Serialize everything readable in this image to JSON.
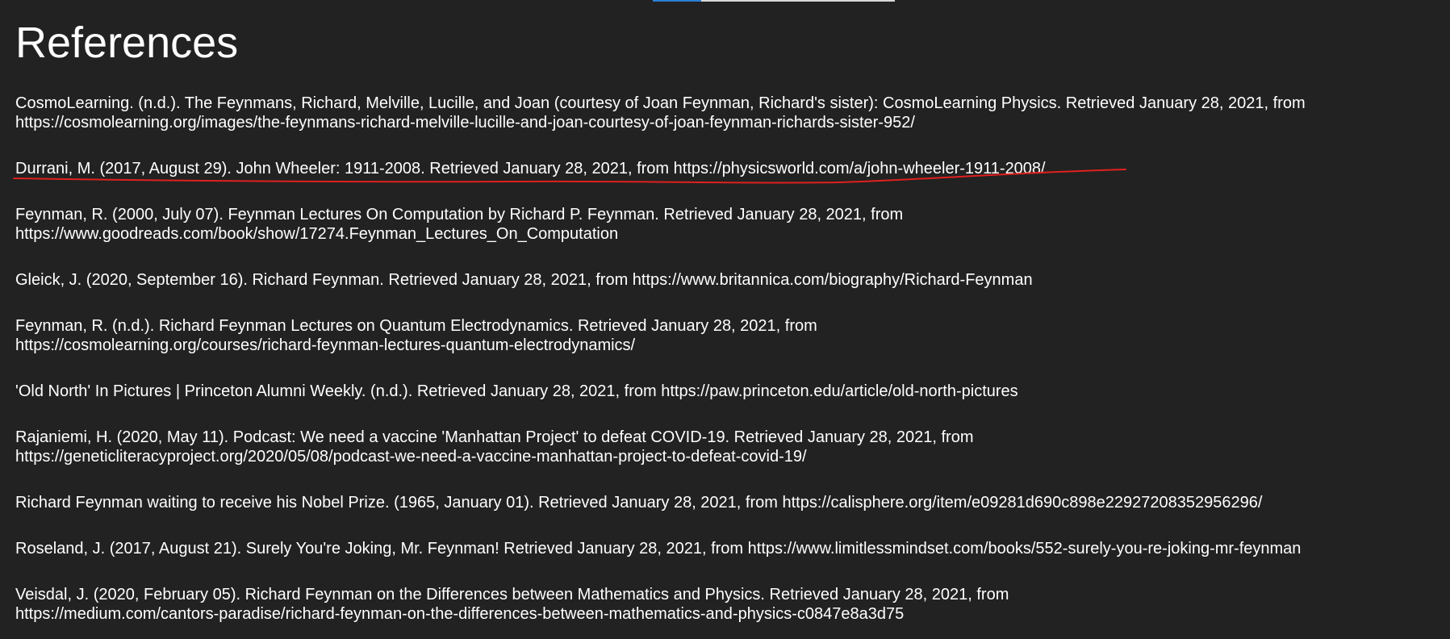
{
  "page": {
    "title": "References"
  },
  "references": [
    {
      "line1": "CosmoLearning. (n.d.). The Feynmans, Richard, Melville, Lucille, and Joan (courtesy of Joan Feynman, Richard's sister): CosmoLearning Physics. Retrieved January 28, 2021, from",
      "line2": "https://cosmolearning.org/images/the-feynmans-richard-melville-lucille-and-joan-courtesy-of-joan-feynman-richards-sister-952/"
    },
    {
      "line1": "Durrani, M. (2017, August 29). John Wheeler: 1911-2008. Retrieved January 28, 2021, from https://physicsworld.com/a/john-wheeler-1911-2008/",
      "line2": ""
    },
    {
      "line1": "Feynman, R. (2000, July 07). Feynman Lectures On Computation by Richard P. Feynman. Retrieved January 28, 2021, from",
      "line2": "https://www.goodreads.com/book/show/17274.Feynman_Lectures_On_Computation"
    },
    {
      "line1": "Gleick, J. (2020, September 16). Richard Feynman. Retrieved January 28, 2021, from https://www.britannica.com/biography/Richard-Feynman",
      "line2": ""
    },
    {
      "line1": "Feynman, R. (n.d.). Richard Feynman Lectures on Quantum Electrodynamics. Retrieved January 28, 2021, from",
      "line2": "https://cosmolearning.org/courses/richard-feynman-lectures-quantum-electrodynamics/"
    },
    {
      "line1": "'Old North' In Pictures | Princeton Alumni Weekly. (n.d.). Retrieved January 28, 2021, from https://paw.princeton.edu/article/old-north-pictures",
      "line2": ""
    },
    {
      "line1": "Rajaniemi, H. (2020, May 11). Podcast: We need a vaccine 'Manhattan Project' to defeat COVID-19. Retrieved January 28, 2021, from",
      "line2": "https://geneticliteracyproject.org/2020/05/08/podcast-we-need-a-vaccine-manhattan-project-to-defeat-covid-19/"
    },
    {
      "line1": "Richard Feynman waiting to receive his Nobel Prize. (1965, January 01). Retrieved January 28, 2021, from https://calisphere.org/item/e09281d690c898e22927208352956296/",
      "line2": ""
    },
    {
      "line1": "Roseland, J. (2017, August 21). Surely You're Joking, Mr. Feynman! Retrieved January 28, 2021, from https://www.limitlessmindset.com/books/552-surely-you-re-joking-mr-feynman",
      "line2": ""
    },
    {
      "line1": "Veisdal, J. (2020, February 05). Richard Feynman on the Differences between Mathematics and Physics. Retrieved January 28, 2021, from",
      "line2": "https://medium.com/cantors-paradise/richard-feynman-on-the-differences-between-mathematics-and-physics-c0847e8a3d75"
    }
  ],
  "annotation": {
    "underline_color": "#e02020"
  }
}
